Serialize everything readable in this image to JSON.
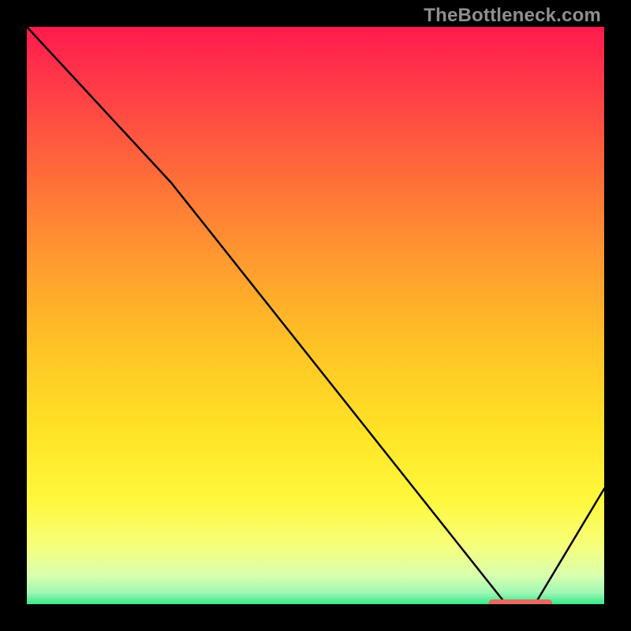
{
  "credit": "TheBottleneck.com",
  "chart_data": {
    "type": "line",
    "title": "",
    "xlabel": "",
    "ylabel": "",
    "xlim": [
      0,
      100
    ],
    "ylim": [
      0,
      100
    ],
    "grid": false,
    "series": [
      {
        "name": "curve",
        "x": [
          0,
          25,
          83,
          88,
          100
        ],
        "values": [
          100,
          73,
          0,
          0,
          20
        ]
      }
    ],
    "marker_segment": {
      "x_start": 80,
      "x_end": 91,
      "y": 0
    },
    "background": "red-yellow-green-vertical-gradient"
  }
}
